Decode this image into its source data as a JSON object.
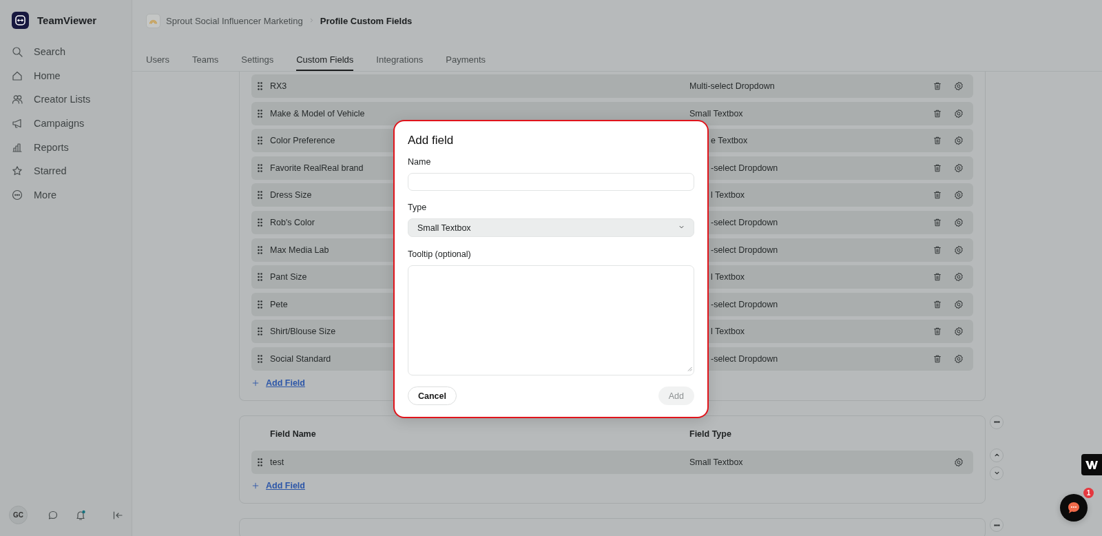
{
  "sidebar": {
    "brand": "TeamViewer",
    "items": [
      {
        "kind": "search",
        "label": "Search",
        "selected": false
      },
      {
        "kind": "home",
        "label": "Home",
        "selected": false
      },
      {
        "kind": "people",
        "label": "Creator Lists",
        "selected": false
      },
      {
        "kind": "megaphone",
        "label": "Campaigns",
        "selected": false
      },
      {
        "kind": "chart",
        "label": "Reports",
        "selected": false
      },
      {
        "kind": "star",
        "label": "Starred",
        "selected": false
      },
      {
        "kind": "more",
        "label": "More",
        "selected": false
      }
    ],
    "avatar": "GC"
  },
  "breadcrumb": [
    "Sprout Social Influencer Marketing",
    "Profile Custom Fields"
  ],
  "tabs": [
    {
      "label": "Users",
      "selected": false
    },
    {
      "label": "Teams",
      "selected": false
    },
    {
      "label": "Settings",
      "selected": false
    },
    {
      "label": "Custom Fields",
      "selected": true
    },
    {
      "label": "Integrations",
      "selected": false
    },
    {
      "label": "Payments",
      "selected": false
    }
  ],
  "field_groups": [
    {
      "rows": [
        {
          "name": "RX3",
          "type": "Multi-select Dropdown",
          "partly_covered": false,
          "deletable": true
        },
        {
          "name": "Make & Model of Vehicle",
          "type": "Small Textbox",
          "partly_covered": false,
          "deletable": true
        },
        {
          "name": "Color Preference",
          "type": "e Textbox",
          "partly_covered": true,
          "deletable": true
        },
        {
          "name": "Favorite RealReal brand",
          "type": "-select Dropdown",
          "partly_covered": true,
          "deletable": true
        },
        {
          "name": "Dress Size",
          "type": "l Textbox",
          "partly_covered": true,
          "deletable": true
        },
        {
          "name": "Rob's Color",
          "type": "-select Dropdown",
          "partly_covered": true,
          "deletable": true
        },
        {
          "name": "Max Media Lab",
          "type": "-select Dropdown",
          "partly_covered": true,
          "deletable": true
        },
        {
          "name": "Pant Size",
          "type": "l Textbox",
          "partly_covered": true,
          "deletable": true
        },
        {
          "name": "Pete",
          "type": "-select Dropdown",
          "partly_covered": true,
          "deletable": true
        },
        {
          "name": "Shirt/Blouse Size",
          "type": "l Textbox",
          "partly_covered": true,
          "deletable": true
        },
        {
          "name": "Social Standard",
          "type": "-select Dropdown",
          "partly_covered": true,
          "deletable": true
        }
      ],
      "add_label": "Add Field",
      "top_cut": true
    },
    {
      "columns": [
        "Field Name",
        "Field Type"
      ],
      "rows": [
        {
          "name": "test",
          "type": "Small Textbox",
          "partly_covered": false,
          "deletable": false
        }
      ],
      "add_label": "Add Field",
      "top_cut": false,
      "side_controls": [
        {
          "kind": "more"
        },
        {
          "kind": "up"
        },
        {
          "kind": "down"
        }
      ]
    },
    {
      "top_cut": false,
      "side_controls": [
        {
          "kind": "more"
        }
      ]
    }
  ],
  "dialog": {
    "title": "Add field",
    "fields": [
      {
        "kind": "text",
        "label": "Name"
      },
      {
        "kind": "select",
        "label": "Type",
        "value": "Small Textbox"
      },
      {
        "kind": "textarea",
        "label": "Tooltip (optional)"
      }
    ],
    "buttons": [
      {
        "label": "Cancel",
        "disabled": false
      },
      {
        "label": "Add",
        "disabled": true
      }
    ]
  },
  "chat": {
    "badge": "1"
  }
}
